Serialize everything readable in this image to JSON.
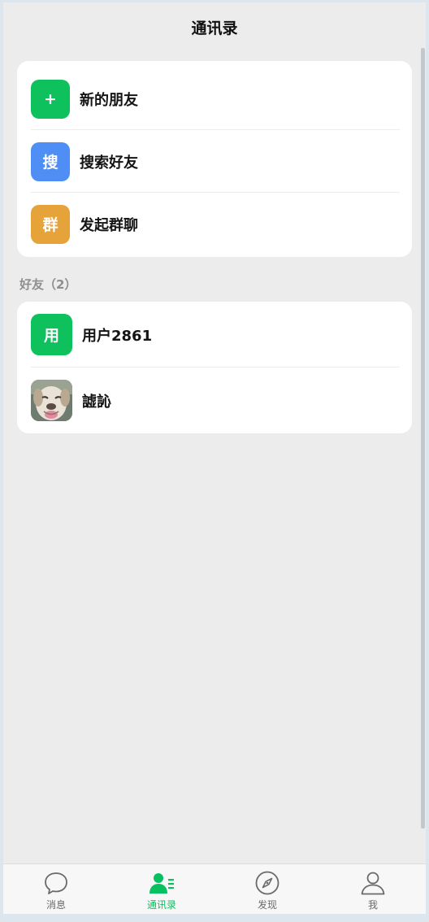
{
  "header": {
    "title": "通讯录"
  },
  "top_menu": [
    {
      "badge": "+",
      "label": "新的朋友",
      "color": "#0fc15c"
    },
    {
      "badge": "搜",
      "label": "搜索好友",
      "color": "#4f8ef5"
    },
    {
      "badge": "群",
      "label": "发起群聊",
      "color": "#e6a33a"
    }
  ],
  "friends_section": {
    "label": "好友（2）",
    "items": [
      {
        "badge": "用",
        "label": "用户2861"
      },
      {
        "avatar": "dog-photo",
        "label": "譃訫"
      }
    ]
  },
  "tabbar": {
    "tabs": [
      {
        "label": "消息",
        "icon": "chat-bubble-icon",
        "active": false
      },
      {
        "label": "通讯录",
        "icon": "contacts-icon",
        "active": true
      },
      {
        "label": "发现",
        "icon": "compass-icon",
        "active": false
      },
      {
        "label": "我",
        "icon": "user-icon",
        "active": false
      }
    ],
    "active_color": "#07c160"
  }
}
